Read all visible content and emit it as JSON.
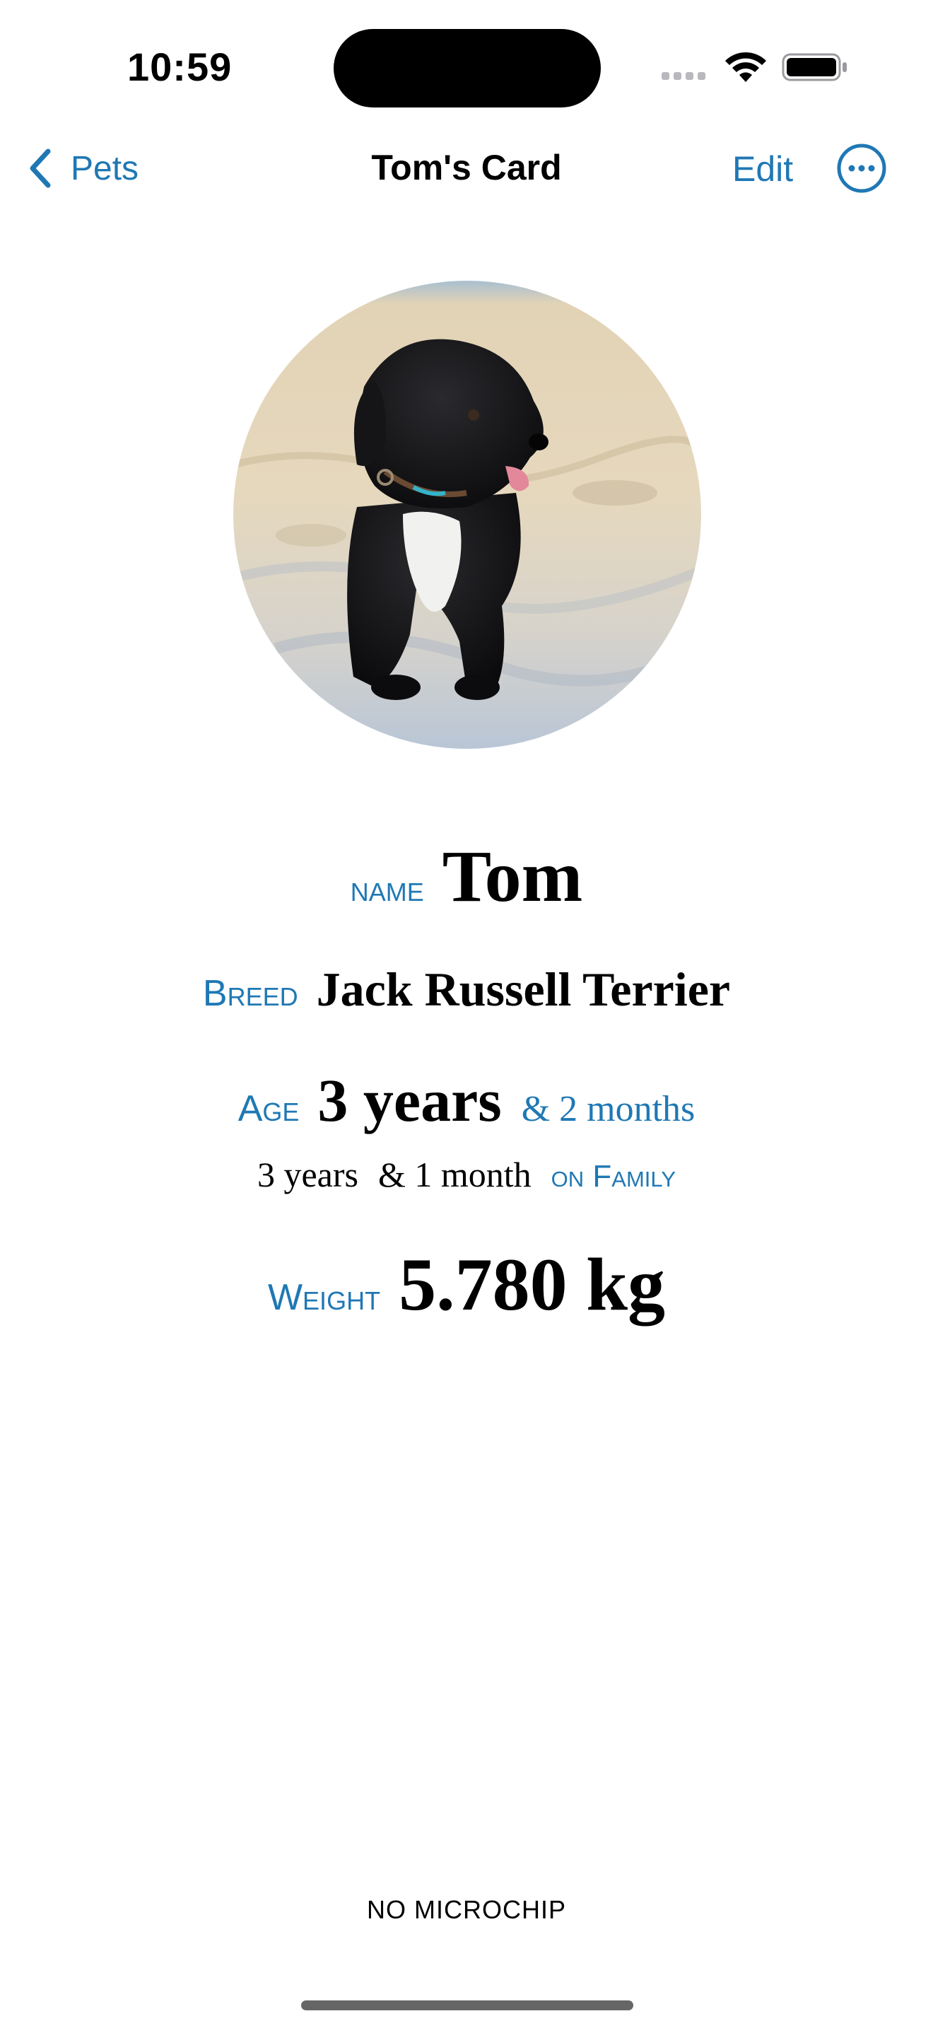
{
  "status_bar": {
    "time": "10:59"
  },
  "nav": {
    "back_label": "Pets",
    "title": "Tom's Card",
    "edit_label": "Edit",
    "accent_color": "#1f78b4"
  },
  "pet": {
    "name_label": "name",
    "name": "Tom",
    "breed_label": "Breed",
    "breed": "Jack Russell Terrier",
    "age_label": "Age",
    "age_years": "3 years",
    "age_months": "& 2 months",
    "family_years": "3 years",
    "family_months": "& 1 month",
    "family_label": "on Family",
    "weight_label": "Weight",
    "weight": "5.780 kg",
    "microchip": "NO MICROCHIP"
  },
  "icons": {
    "back": "chevron-left-icon",
    "more": "ellipsis-circle-icon",
    "wifi": "wifi-icon",
    "battery": "battery-icon",
    "signal": "cellular-signal-icon"
  }
}
